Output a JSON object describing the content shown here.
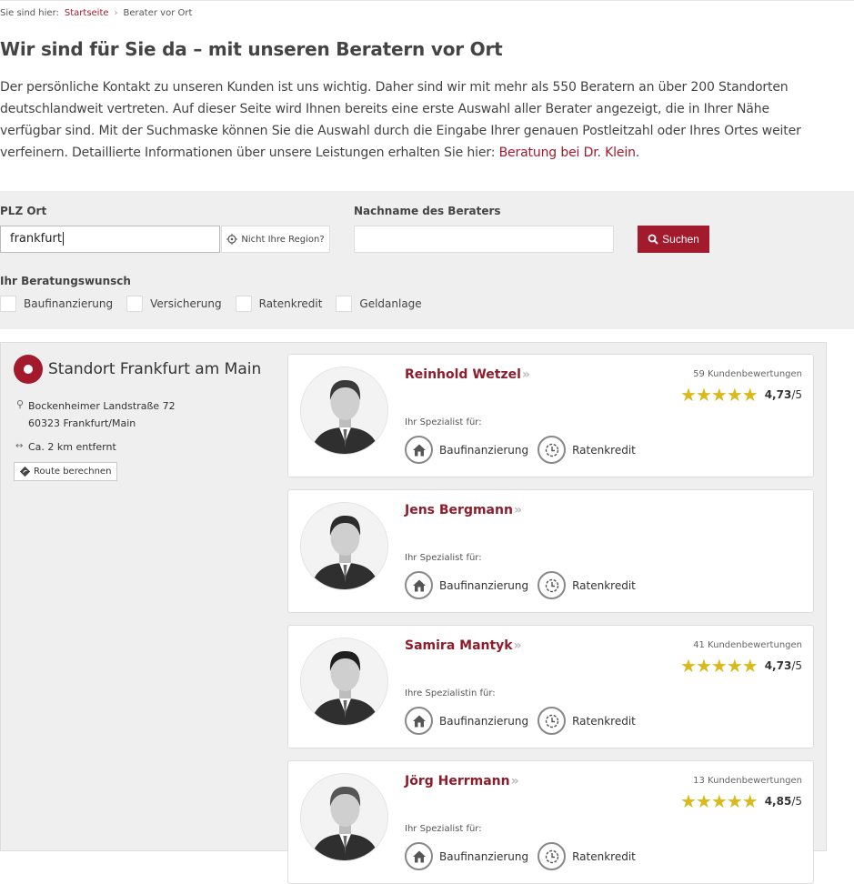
{
  "breadcrumb": {
    "prefix": "Sie sind hier:",
    "home": "Startseite",
    "sep": "›",
    "current": "Berater vor Ort"
  },
  "page": {
    "title": "Wir sind für Sie da – mit unseren Beratern vor Ort",
    "intro": "Der persönliche Kontakt zu unseren Kunden ist uns wichtig. Daher sind wir mit mehr als 550 Beratern an über 200 Standorten deutschlandweit vertreten. Auf dieser Seite wird Ihnen bereits eine erste Auswahl aller Berater angezeigt, die in Ihrer Nähe verfügbar sind. Mit der Suchmaske können Sie die Auswahl durch die Eingabe Ihrer genauen Postleitzahl oder Ihres Ortes weiter verfeinern. Detaillierte Informationen über unsere Leistungen erhalten Sie hier: ",
    "intro_link": "Beratung bei Dr. Klein",
    "intro_end": "."
  },
  "search": {
    "plz_label": "PLZ Ort",
    "plz_value": "frankfurt",
    "region_button": "Nicht Ihre Region?",
    "name_label": "Nachname des Beraters",
    "name_value": "",
    "submit": "Suchen",
    "wish_label": "Ihr Beratungswunsch",
    "options": [
      "Baufinanzierung",
      "Versicherung",
      "Ratenkredit",
      "Geldanlage"
    ]
  },
  "location": {
    "title": "Standort Frankfurt am Main",
    "street": "Bockenheimer Landstraße 72",
    "city": "60323 Frankfurt/Main",
    "distance": "Ca. 2 km entfernt",
    "route_button": "Route berechnen"
  },
  "advisors": [
    {
      "name": "Reinhold Wetzel",
      "reviews": "59 Kundenbewertungen",
      "stars": "★★★★★",
      "score": "4,73",
      "max": "/5",
      "specialist": "Ihr Spezialist für:",
      "areas": [
        "Baufinanzierung",
        "Ratenkredit"
      ],
      "hair": "#3a3a3a"
    },
    {
      "name": "Jens Bergmann",
      "reviews": "",
      "stars": "",
      "score": "",
      "max": "",
      "specialist": "Ihr Spezialist für:",
      "areas": [
        "Baufinanzierung",
        "Ratenkredit"
      ],
      "hair": "#2b2b2b"
    },
    {
      "name": "Samira Mantyk",
      "reviews": "41 Kundenbewertungen",
      "stars": "★★★★★",
      "score": "4,73",
      "max": "/5",
      "specialist": "Ihre Spezialistin für:",
      "areas": [
        "Baufinanzierung",
        "Ratenkredit"
      ],
      "hair": "#1f1f1f"
    },
    {
      "name": "Jörg Herrmann",
      "reviews": "13 Kundenbewertungen",
      "stars": "★★★★★",
      "score": "4,85",
      "max": "/5",
      "specialist": "Ihr Spezialist für:",
      "areas": [
        "Baufinanzierung",
        "Ratenkredit"
      ],
      "hair": "#555555"
    }
  ],
  "colors": {
    "brand": "#a31a2c",
    "name": "#8e1d2c",
    "star": "#d9b91c",
    "panel": "#efefef"
  },
  "icons": {
    "home": "home-icon",
    "loan": "clock-arrows-icon",
    "pin": "map-pin-icon",
    "distance": "distance-icon",
    "route": "route-icon",
    "region": "target-icon",
    "search": "search-icon"
  }
}
